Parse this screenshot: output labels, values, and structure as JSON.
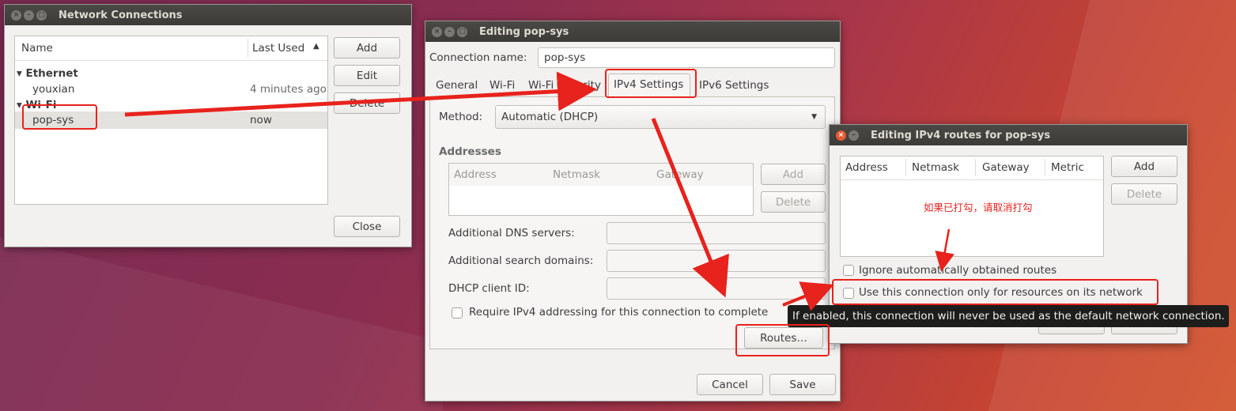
{
  "network_connections": {
    "title": "Network Connections",
    "col_name": "Name",
    "col_last_used": "Last Used",
    "sort_indicator": "▲",
    "groups": [
      {
        "name": "Ethernet",
        "items": [
          {
            "name": "youxian",
            "last_used": "4 minutes ago"
          }
        ]
      },
      {
        "name": "Wi-Fi",
        "items": [
          {
            "name": "pop-sys",
            "last_used": "now"
          }
        ]
      }
    ],
    "add_label": "Add",
    "edit_label": "Edit",
    "delete_label": "Delete",
    "close_label": "Close"
  },
  "editing": {
    "title": "Editing pop-sys",
    "connection_name_label": "Connection name:",
    "connection_name_value": "pop-sys",
    "tabs": [
      "General",
      "Wi-Fi",
      "Wi-Fi Security",
      "IPv4 Settings",
      "IPv6 Settings"
    ],
    "active_tab": "IPv4 Settings",
    "method_label": "Method:",
    "method_value": "Automatic (DHCP)",
    "addresses_label": "Addresses",
    "addr_cols": [
      "Address",
      "Netmask",
      "Gateway"
    ],
    "add_label": "Add",
    "delete_label": "Delete",
    "dns_label": "Additional DNS servers:",
    "search_label": "Additional search domains:",
    "dhcp_label": "DHCP client ID:",
    "require_label": "Require IPv4 addressing for this connection to complete",
    "require_checked": false,
    "routes_label": "Routes…",
    "cancel_label": "Cancel",
    "save_label": "Save"
  },
  "routes": {
    "title": "Editing IPv4 routes for pop-sys",
    "cols": [
      "Address",
      "Netmask",
      "Gateway",
      "Metric"
    ],
    "add_label": "Add",
    "delete_label": "Delete",
    "annotation": "如果已打勾，请取消打勾",
    "ignore_label": "Ignore automatically obtained routes",
    "ignore_checked": false,
    "use_only_label": "Use this connection only for resources on its network",
    "use_only_checked": false,
    "tooltip": "If enabled, this connection will never be used as the default network connection."
  },
  "colors": {
    "highlight": "#e8221c",
    "titlebar": "#3c3b37",
    "close_button": "#e85a31"
  }
}
